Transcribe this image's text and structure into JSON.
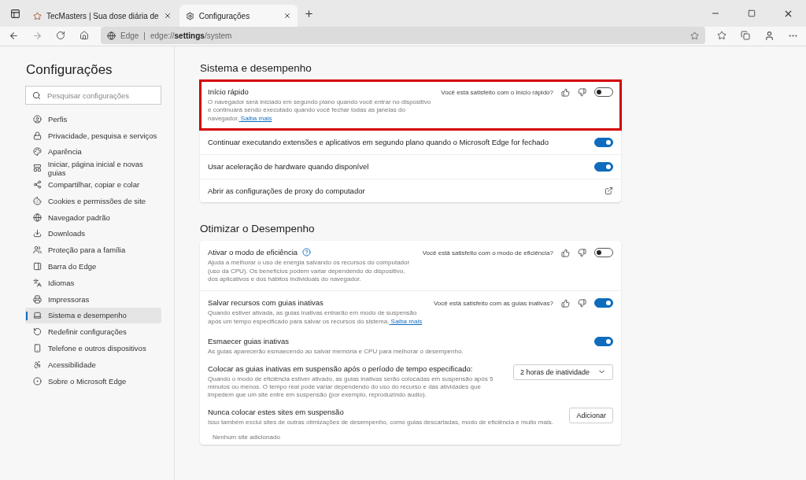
{
  "tabs": [
    {
      "title": "TecMasters | Sua dose diária de",
      "selected": false
    },
    {
      "title": "Configurações",
      "selected": true
    }
  ],
  "address": {
    "brand": "Edge",
    "separator": "|",
    "url_prefix": "edge://",
    "url_bold": "settings",
    "url_suffix": "/system"
  },
  "sidebar": {
    "title": "Configurações",
    "search_placeholder": "Pesquisar configurações",
    "items": [
      {
        "label": "Perfis",
        "selected": false
      },
      {
        "label": "Privacidade, pesquisa e serviços",
        "selected": false
      },
      {
        "label": "Aparência",
        "selected": false
      },
      {
        "label": "Iniciar, página inicial e novas guias",
        "selected": false
      },
      {
        "label": "Compartilhar, copiar e colar",
        "selected": false
      },
      {
        "label": "Cookies e permissões de site",
        "selected": false
      },
      {
        "label": "Navegador padrão",
        "selected": false
      },
      {
        "label": "Downloads",
        "selected": false
      },
      {
        "label": "Proteção para a família",
        "selected": false
      },
      {
        "label": "Barra do Edge",
        "selected": false
      },
      {
        "label": "Idiomas",
        "selected": false
      },
      {
        "label": "Impressoras",
        "selected": false
      },
      {
        "label": "Sistema e desempenho",
        "selected": true
      },
      {
        "label": "Redefinir configurações",
        "selected": false
      },
      {
        "label": "Telefone e outros dispositivos",
        "selected": false
      },
      {
        "label": "Acessibilidade",
        "selected": false
      },
      {
        "label": "Sobre o Microsoft Edge",
        "selected": false
      }
    ]
  },
  "sections": [
    {
      "title": "Sistema e desempenho",
      "rows": [
        {
          "kind": "toggle",
          "title": "Início rápido",
          "description": "O navegador será iniciado em segundo plano quando você entrar no dispositivo e continuará sendo executado quando você fechar todas as janelas do navegador.",
          "link": "Saiba mais",
          "feedback": "Você está satisfeito com o início rápido?",
          "on": false,
          "highlighted": true
        },
        {
          "kind": "toggle",
          "title": "Continuar executando extensões e aplicativos em segundo plano quando o Microsoft Edge for fechado",
          "on": true
        },
        {
          "kind": "toggle",
          "title": "Usar aceleração de hardware quando disponível",
          "on": true
        },
        {
          "kind": "external",
          "title": "Abrir as configurações de proxy do computador"
        }
      ]
    },
    {
      "title": "Otimizar o Desempenho",
      "rows": [
        {
          "kind": "toggle",
          "title": "Ativar o modo de eficiência",
          "help": true,
          "description": "Ajuda a melhorar o uso de energia salvando os recursos do computador (uso da CPU). Os benefícios podem variar dependendo do dispositivo, dos aplicativos e dos hábitos individuais do navegador.",
          "feedback": "Você está satisfeito com o modo de eficiência?",
          "on": false
        },
        {
          "kind": "toggle",
          "title": "Salvar recursos com guias inativas",
          "description": "Quando estiver ativada, as guias inativas entrarão em modo de suspensão após um tempo especificado para salvar os recursos do sistema.",
          "link": "Saiba mais",
          "feedback": "Você está satisfeito com as guias inativas?",
          "on": true
        },
        {
          "kind": "toggle",
          "title": "Esmaecer guias inativas",
          "description": "As guias aparecerão esmaecendo ao salvar memória e CPU para melhorar o desempenho.",
          "on": true,
          "sub": true
        },
        {
          "kind": "dropdown",
          "title": "Colocar as guias inativas em suspensão após o período de tempo especificado:",
          "description": "Quando o modo de eficiência estiver ativado, as guias inativas serão colocadas em suspensão após 5 minutos ou menos. O tempo real pode variar dependendo do uso do recurso e das atividades que impedem que um site entre em suspensão (por exemplo, reproduzindo áudio).",
          "value": "2 horas de inatividade",
          "sub": true
        },
        {
          "kind": "button",
          "title": "Nunca colocar estes sites em suspensão",
          "description": "Isso também exclui sites de outras otimizações de desempenho, como guias descartadas, modo de eficiência e muito mais.",
          "button": "Adicionar",
          "note": "Nenhum site adicionado",
          "sub": true
        }
      ]
    }
  ]
}
